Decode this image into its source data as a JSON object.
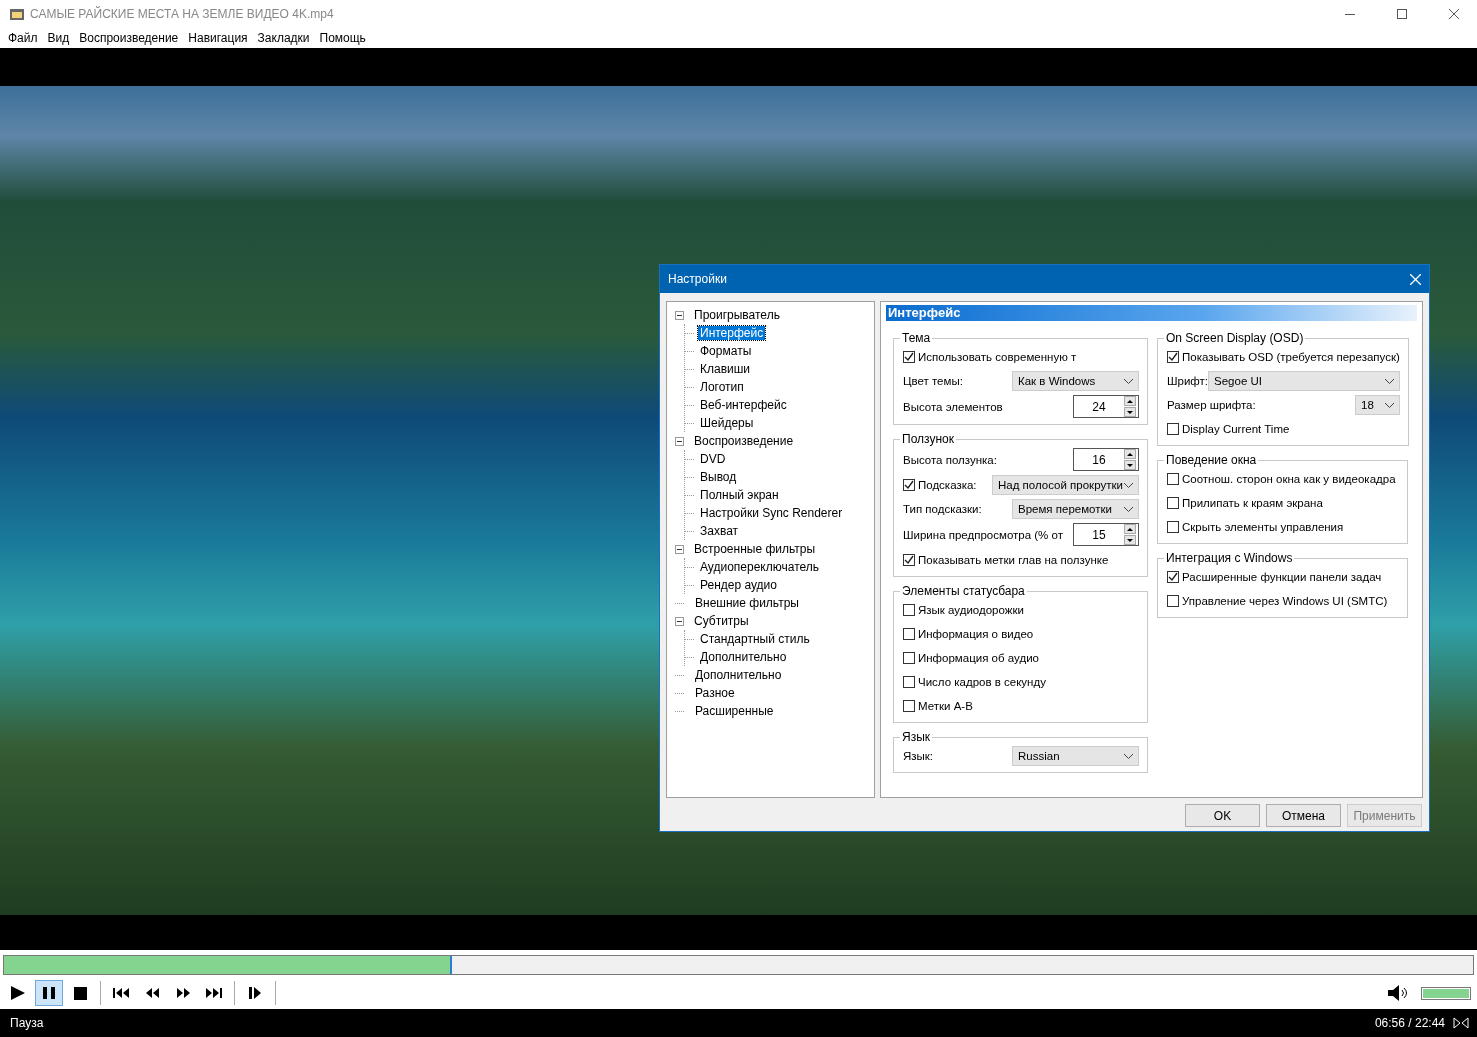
{
  "window": {
    "title": "САМЫЕ РАЙСКИЕ МЕСТА НА ЗЕМЛЕ ВИДЕО 4K.mp4"
  },
  "menu": [
    "Файл",
    "Вид",
    "Воспроизведение",
    "Навигация",
    "Закладки",
    "Помощь"
  ],
  "dialog": {
    "title": "Настройки",
    "tree": [
      {
        "label": "Проигрыватель",
        "selected": false,
        "expanded": true,
        "children": [
          {
            "label": "Интерфейс",
            "selected": true
          },
          {
            "label": "Форматы",
            "selected": false
          },
          {
            "label": "Клавиши",
            "selected": false
          },
          {
            "label": "Логотип",
            "selected": false
          },
          {
            "label": "Веб-интерфейс",
            "selected": false
          },
          {
            "label": "Шейдеры",
            "selected": false
          }
        ]
      },
      {
        "label": "Воспроизведение",
        "selected": false,
        "expanded": true,
        "children": [
          {
            "label": "DVD",
            "selected": false
          },
          {
            "label": "Вывод",
            "selected": false
          },
          {
            "label": "Полный экран",
            "selected": false
          },
          {
            "label": "Настройки Sync Renderer",
            "selected": false
          },
          {
            "label": "Захват",
            "selected": false
          }
        ]
      },
      {
        "label": "Встроенные фильтры",
        "selected": false,
        "expanded": true,
        "children": [
          {
            "label": "Аудиопереключатель",
            "selected": false
          },
          {
            "label": "Рендер аудио",
            "selected": false
          }
        ]
      },
      {
        "label": "Внешние фильтры",
        "selected": false
      },
      {
        "label": "Субтитры",
        "selected": false,
        "expanded": true,
        "children": [
          {
            "label": "Стандартный стиль",
            "selected": false
          },
          {
            "label": "Дополнительно",
            "selected": false
          }
        ]
      },
      {
        "label": "Дополнительно",
        "selected": false
      },
      {
        "label": "Разное",
        "selected": false
      },
      {
        "label": "Расширенные",
        "selected": false
      }
    ],
    "page_title": "Интерфейс",
    "columns": [
      [
        {
          "title": "Тема",
          "rows": [
            {
              "kind": "checkbox",
              "label": "Использовать современную т",
              "checked": true
            },
            {
              "kind": "select",
              "label": "Цвет темы:",
              "value": "Как в Windows"
            },
            {
              "kind": "spin",
              "label": "Высота элементов",
              "value": "24"
            }
          ]
        },
        {
          "title": "Ползунок",
          "rows": [
            {
              "kind": "spin",
              "label": "Высота ползунка:",
              "value": "16"
            },
            {
              "kind": "check_select",
              "label": "Подсказка:",
              "checked": true,
              "value": "Над полосой прокрутки"
            },
            {
              "kind": "select",
              "label": "Тип подсказки:",
              "value": "Время перемотки"
            },
            {
              "kind": "spin",
              "label": "Ширина предпросмотра (% от",
              "value": "15"
            },
            {
              "kind": "checkbox",
              "label": "Показывать метки глав на ползунке",
              "checked": true
            }
          ]
        },
        {
          "title": "Элементы статусбара",
          "rows": [
            {
              "kind": "checkbox",
              "label": "Язык аудиодорожки",
              "checked": false
            },
            {
              "kind": "checkbox",
              "label": "Информация о видео",
              "checked": false
            },
            {
              "kind": "checkbox",
              "label": "Информация об аудио",
              "checked": false
            },
            {
              "kind": "checkbox",
              "label": "Число кадров в секунду",
              "checked": false
            },
            {
              "kind": "checkbox",
              "label": "Метки A-B",
              "checked": false
            }
          ]
        },
        {
          "title": "Язык",
          "rows": [
            {
              "kind": "select",
              "label": "Язык:",
              "value": "Russian"
            }
          ]
        }
      ],
      [
        {
          "title": "On Screen Display (OSD)",
          "rows": [
            {
              "kind": "checkbox",
              "label": "Показывать OSD (требуется перезапуск)",
              "checked": true
            },
            {
              "kind": "wide_select",
              "label": "Шрифт:",
              "value": "Segoe UI"
            },
            {
              "kind": "small_select",
              "label": "Размер шрифта:",
              "value": "18"
            },
            {
              "kind": "checkbox",
              "label": "Display Current Time",
              "checked": false
            }
          ]
        },
        {
          "title": "Поведение окна",
          "rows": [
            {
              "kind": "checkbox",
              "label": "Соотнош. сторон окна как у видеокадра",
              "checked": false
            },
            {
              "kind": "checkbox",
              "label": "Прилипать к краям экрана",
              "checked": false
            },
            {
              "kind": "checkbox",
              "label": "Скрыть элементы управления",
              "checked": false
            }
          ]
        },
        {
          "title": "Интеграция с Windows",
          "rows": [
            {
              "kind": "checkbox",
              "label": "Расширенные функции панели задач",
              "checked": true
            },
            {
              "kind": "checkbox",
              "label": "Управление через Windows UI (SMTC)",
              "checked": false
            }
          ]
        }
      ]
    ],
    "buttons": [
      {
        "label": "OK",
        "disabled": false
      },
      {
        "label": "Отмена",
        "disabled": false
      },
      {
        "label": "Применить",
        "disabled": true
      }
    ]
  },
  "seek": {
    "level": 0.305
  },
  "controls": [
    {
      "kind": "play",
      "selected": false
    },
    {
      "kind": "pause",
      "selected": true
    },
    {
      "kind": "stop",
      "selected": false
    },
    {
      "kind": "sep"
    },
    {
      "kind": "prev",
      "selected": false
    },
    {
      "kind": "rewind",
      "selected": false
    },
    {
      "kind": "forward",
      "selected": false
    },
    {
      "kind": "next",
      "selected": false
    },
    {
      "kind": "sep"
    },
    {
      "kind": "step",
      "selected": false
    },
    {
      "kind": "sep"
    }
  ],
  "volume": {
    "level": 1
  },
  "status_bar": {
    "state": "Пауза",
    "time": "06:56 / 22:44"
  }
}
